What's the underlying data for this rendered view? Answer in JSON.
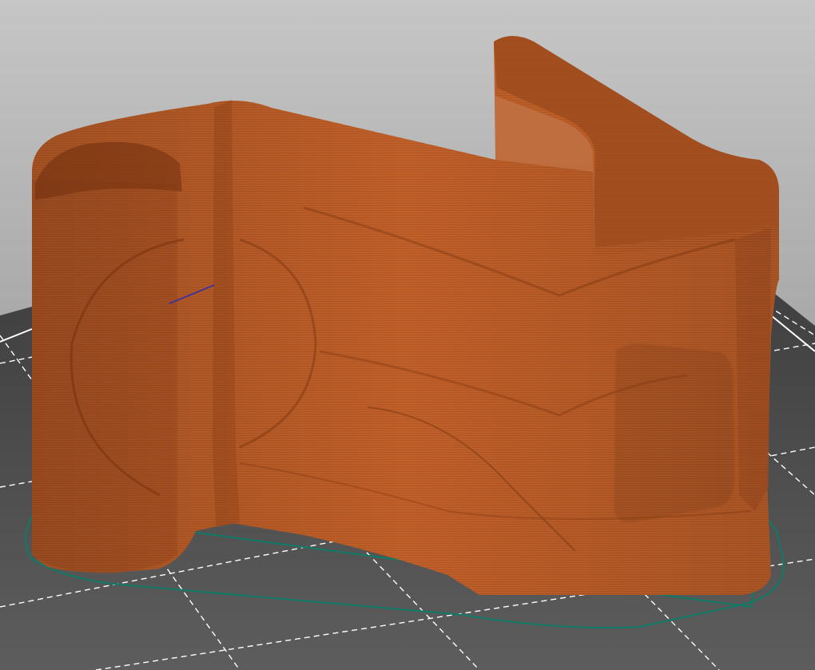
{
  "viewport": {
    "kind": "3d-gcode-preview",
    "background_top": "#c6c6c6",
    "background_bottom": "#8a8a8a",
    "bed_color": "#4d4d4d",
    "grid_color": "#ffffff",
    "model_color": "#c0602a",
    "model_shade_color": "#a44f20",
    "skirt_color": "#0f7a66",
    "travel_color": "#2f2fb0",
    "icons": [
      "print-bed-grid",
      "printed-object",
      "skirt-outline",
      "travel-move"
    ]
  }
}
